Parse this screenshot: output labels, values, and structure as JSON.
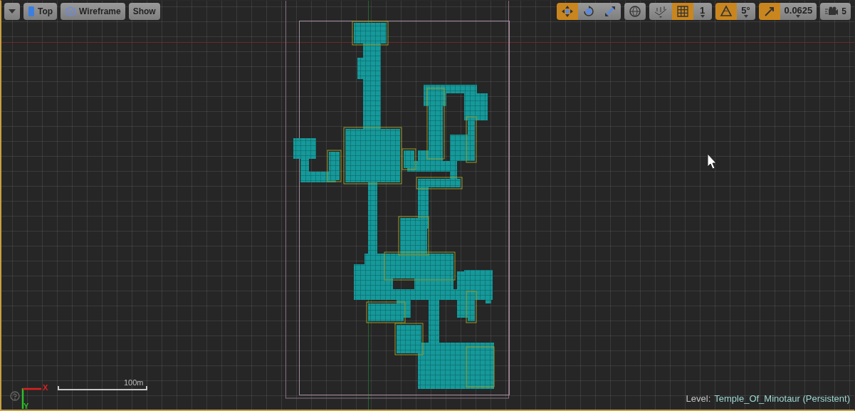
{
  "view_toolbar": {
    "projection": "Top",
    "view_mode": "Wireframe",
    "show": "Show"
  },
  "transform_tools": [
    {
      "kind": "move",
      "selected": true
    },
    {
      "kind": "rotate",
      "selected": false
    },
    {
      "kind": "scale",
      "selected": false
    }
  ],
  "surface_snap": {
    "on": false
  },
  "snaps": [
    {
      "kind": "grid",
      "on": true,
      "value": "1"
    },
    {
      "kind": "rotation",
      "on": true,
      "value": "5°"
    },
    {
      "kind": "scale",
      "on": true,
      "value": "0.0625"
    }
  ],
  "camera_speed": "5",
  "axes": {
    "x": "X",
    "y": "Y"
  },
  "scale_bar": "100m",
  "level": {
    "label": "Level:",
    "name": "Temple_Of_Minotaur (Persistent)"
  }
}
